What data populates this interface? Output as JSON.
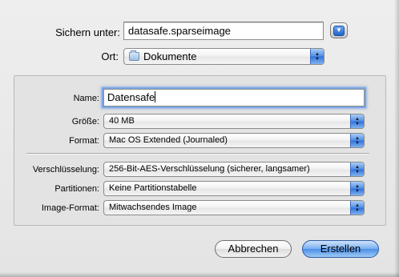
{
  "header": {
    "save_as_label": "Sichern unter:",
    "save_as_value": "datasafe.sparseimage",
    "where_label": "Ort:",
    "where_value": "Dokumente",
    "where_icon": "folder-icon"
  },
  "settings": {
    "name_label": "Name:",
    "name_value": "Datensafe",
    "size_label": "Größe:",
    "size_value": "40 MB",
    "format_label": "Format:",
    "format_value": "Mac OS Extended (Journaled)",
    "encryption_label": "Verschlüsselung:",
    "encryption_value": "256-Bit-AES-Verschlüsselung (sicherer, langsamer)",
    "partitions_label": "Partitionen:",
    "partitions_value": "Keine Partitionstabelle",
    "image_format_label": "Image-Format:",
    "image_format_value": "Mitwachsendes Image"
  },
  "buttons": {
    "cancel_label": "Abbrechen",
    "create_label": "Erstellen"
  },
  "colors": {
    "accent": "#4d8fe6",
    "focus_ring": "#7aa7e6",
    "background": "#e8e8e8"
  }
}
